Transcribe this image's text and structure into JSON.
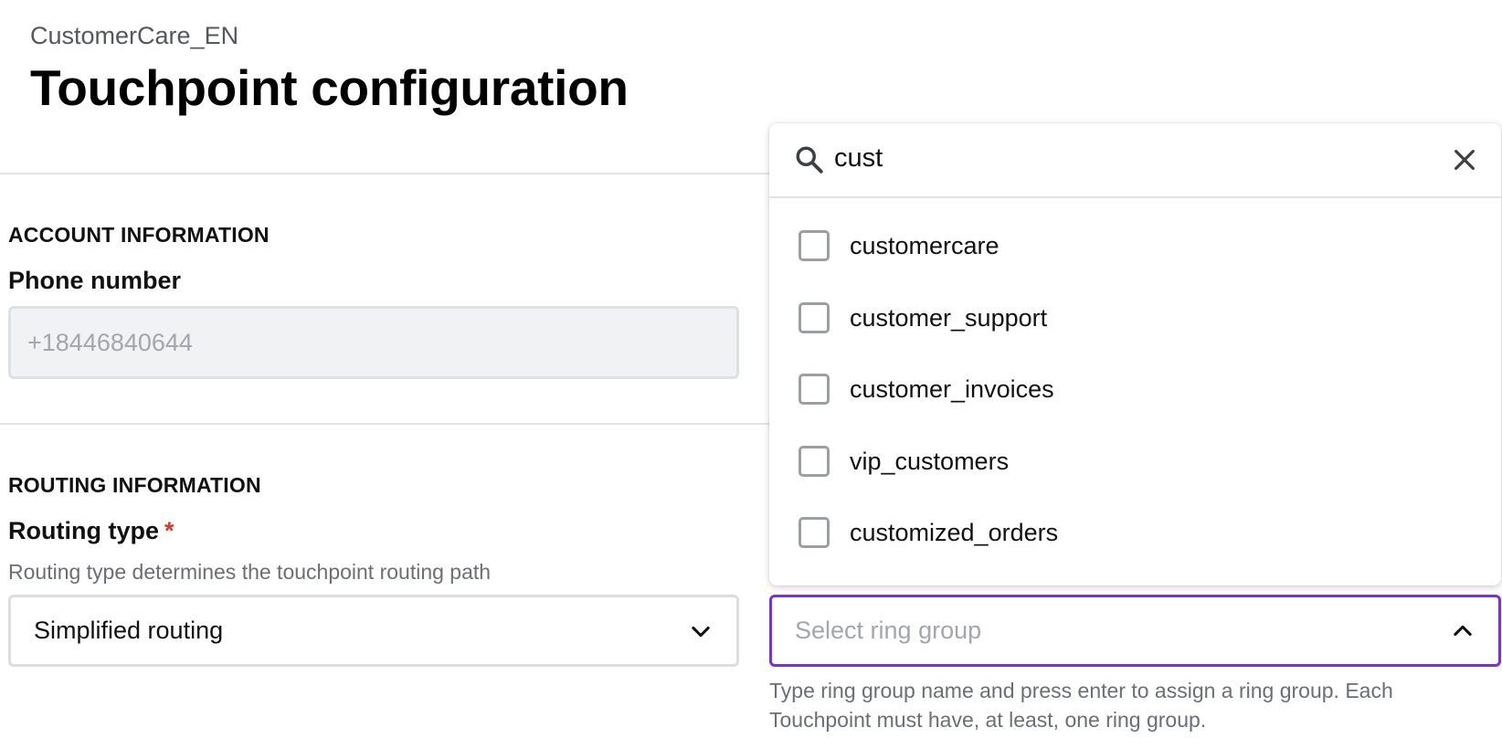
{
  "header": {
    "breadcrumb": "CustomerCare_EN",
    "title": "Touchpoint configuration"
  },
  "account_section": {
    "heading": "ACCOUNT INFORMATION",
    "phone_label": "Phone number",
    "phone_value": "+18446840644"
  },
  "routing_section": {
    "heading": "ROUTING INFORMATION",
    "routing_type_label": "Routing type",
    "required_marker": "*",
    "routing_type_help": "Routing type determines the touchpoint routing path",
    "routing_type_value": "Simplified routing"
  },
  "ring_group": {
    "placeholder": "Select ring group",
    "help": "Type ring group name and press enter to assign a ring group. Each Touchpoint must have, at least, one ring group.",
    "search_value": "cust",
    "options": [
      {
        "label": "customercare",
        "checked": false
      },
      {
        "label": "customer_support",
        "checked": false
      },
      {
        "label": "customer_invoices",
        "checked": false
      },
      {
        "label": "vip_customers",
        "checked": false
      },
      {
        "label": "customized_orders",
        "checked": false
      }
    ]
  },
  "colors": {
    "accent": "#7a2ee0",
    "required": "#d23b2e",
    "disabled_bg": "#f1f2f4"
  },
  "icons": {
    "search": "search-icon",
    "clear": "close-icon",
    "routing_chevron": "chevron-down-icon",
    "ring_chevron": "chevron-up-icon"
  }
}
